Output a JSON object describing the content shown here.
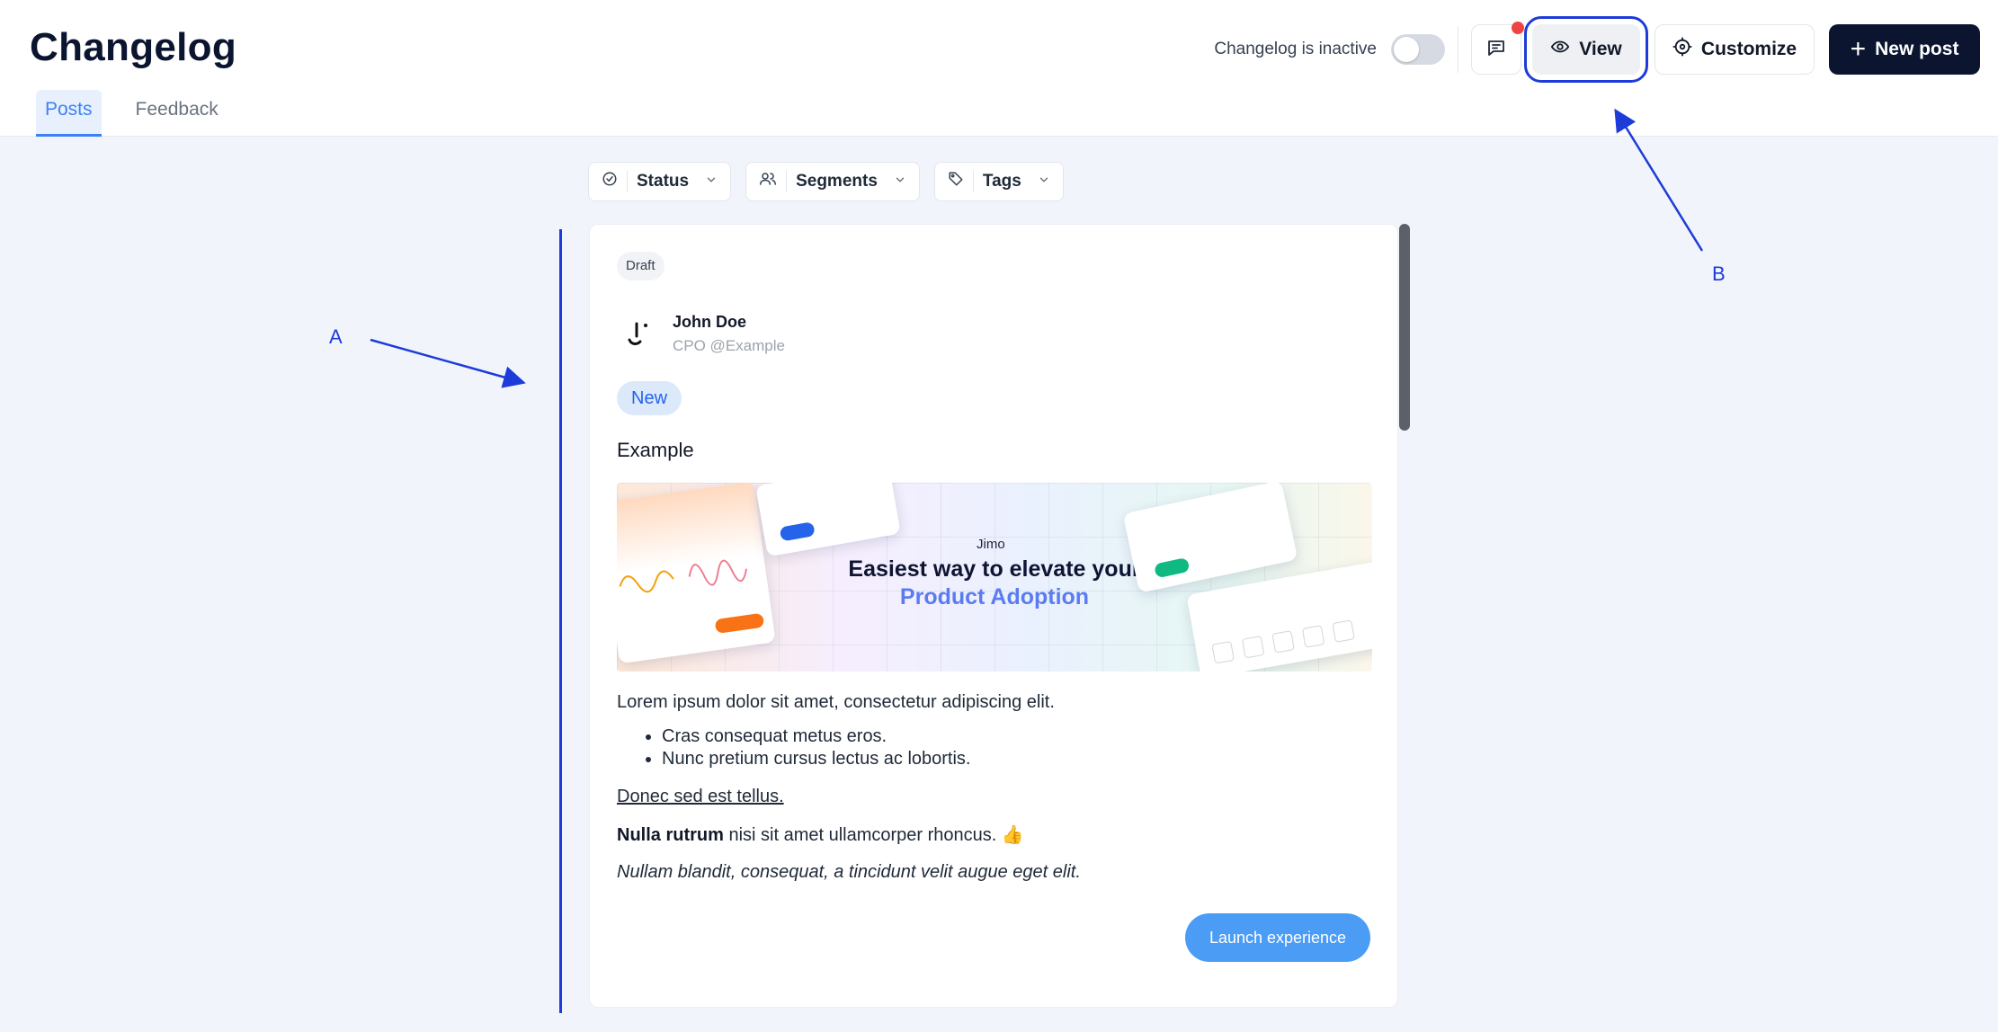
{
  "header": {
    "title": "Changelog",
    "tabs": [
      {
        "label": "Posts",
        "active": true
      },
      {
        "label": "Feedback",
        "active": false
      }
    ],
    "toggle_label": "Changelog is inactive",
    "toggle_state": "off",
    "feedback_icon": "chat-icon",
    "view_label": "View",
    "customize_label": "Customize",
    "new_post_label": "New post"
  },
  "filters": [
    {
      "label": "Status",
      "icon": "check-circle-icon"
    },
    {
      "label": "Segments",
      "icon": "users-icon"
    },
    {
      "label": "Tags",
      "icon": "tag-icon"
    }
  ],
  "post": {
    "status": "Draft",
    "author_name": "John Doe",
    "author_role": "CPO @Example",
    "badge": "New",
    "title": "Example",
    "banner": {
      "logo": "Jimo",
      "line1": "Easiest way to elevate your",
      "line2": "Product Adoption"
    },
    "intro": "Lorem ipsum dolor sit amet, consectetur adipiscing elit.",
    "bullets": [
      "Cras consequat metus eros.",
      "Nunc pretium cursus lectus ac lobortis."
    ],
    "underlined": "Donec sed est tellus.",
    "bold_lead": "Nulla rutrum",
    "bold_rest": " nisi sit amet ullamcorper rhoncus. 👍",
    "italic": "Nullam blandit, consequat, a tincidunt velit augue eget elit.",
    "cta": "Launch experience"
  },
  "annotations": {
    "a": "A",
    "b": "B"
  },
  "colors": {
    "primary_dark": "#0b1530",
    "accent_blue": "#3b82f6",
    "annotation": "#1d3bd8",
    "notification": "#ef4444"
  }
}
